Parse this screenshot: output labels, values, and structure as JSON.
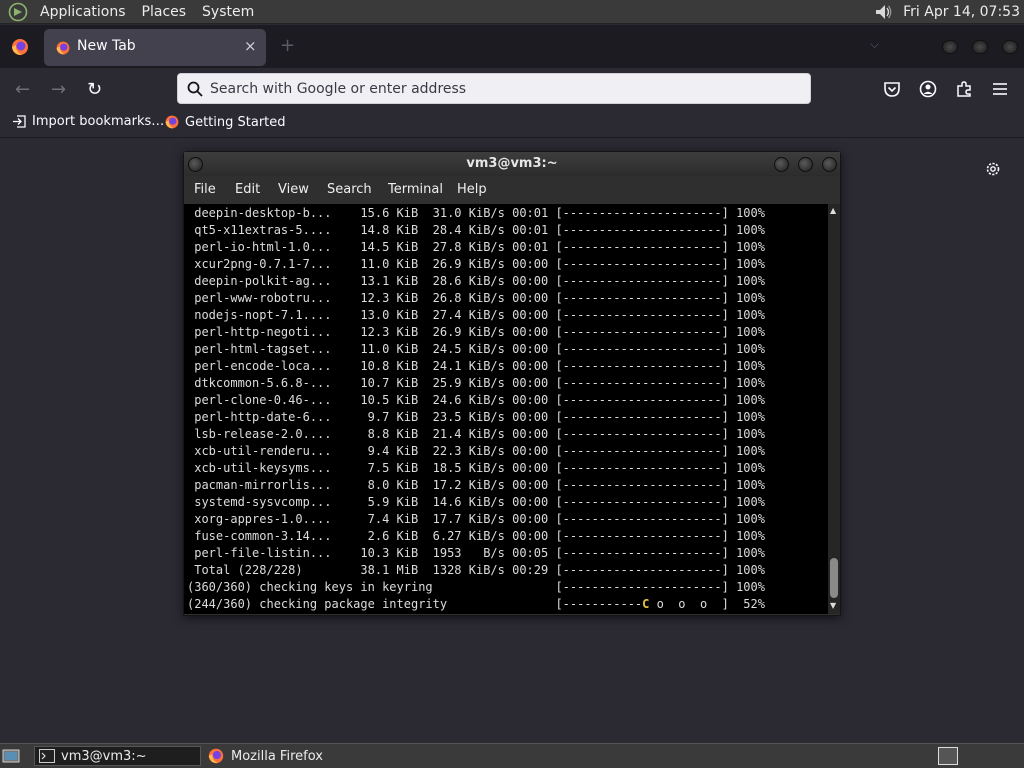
{
  "top_panel": {
    "menus": [
      "Applications",
      "Places",
      "System"
    ],
    "clock": "Fri Apr 14, 07:53",
    "icons": [
      "mate-logo-icon",
      "volume-icon"
    ]
  },
  "browser": {
    "tab": {
      "label": "New Tab",
      "close": "×"
    },
    "new_tab": "+",
    "list_tabs": "⌵",
    "nav": {
      "back": "←",
      "forward": "→",
      "reload": "↻"
    },
    "urlbar": {
      "placeholder": "Search with Google or enter address",
      "value": ""
    },
    "toolbar_icons": [
      "pocket-icon",
      "account-icon",
      "extensions-icon",
      "menu-icon"
    ],
    "bookmarks": [
      {
        "label": "Import bookmarks…",
        "icon": "import-icon"
      },
      {
        "label": "Getting Started",
        "icon": "firefox-icon"
      }
    ],
    "accent": "#1c1b22",
    "content_bg": "#2b2a33"
  },
  "terminal": {
    "title": "vm3@vm3:~",
    "menus": [
      "File",
      "Edit",
      "View",
      "Search",
      "Terminal",
      "Help"
    ],
    "lines": [
      " deepin-desktop-b...    15.6 KiB  31.0 KiB/s 00:01 [----------------------] 100%",
      " qt5-x11extras-5....    14.8 KiB  28.4 KiB/s 00:01 [----------------------] 100%",
      " perl-io-html-1.0...    14.5 KiB  27.8 KiB/s 00:01 [----------------------] 100%",
      " xcur2png-0.7.1-7...    11.0 KiB  26.9 KiB/s 00:00 [----------------------] 100%",
      " deepin-polkit-ag...    13.1 KiB  28.6 KiB/s 00:00 [----------------------] 100%",
      " perl-www-robotru...    12.3 KiB  26.8 KiB/s 00:00 [----------------------] 100%",
      " nodejs-nopt-7.1....    13.0 KiB  27.4 KiB/s 00:00 [----------------------] 100%",
      " perl-http-negoti...    12.3 KiB  26.9 KiB/s 00:00 [----------------------] 100%",
      " perl-html-tagset...    11.0 KiB  24.5 KiB/s 00:00 [----------------------] 100%",
      " perl-encode-loca...    10.8 KiB  24.1 KiB/s 00:00 [----------------------] 100%",
      " dtkcommon-5.6.8-...    10.7 KiB  25.9 KiB/s 00:00 [----------------------] 100%",
      " perl-clone-0.46-...    10.5 KiB  24.6 KiB/s 00:00 [----------------------] 100%",
      " perl-http-date-6...     9.7 KiB  23.5 KiB/s 00:00 [----------------------] 100%",
      " lsb-release-2.0....     8.8 KiB  21.4 KiB/s 00:00 [----------------------] 100%",
      " xcb-util-renderu...     9.4 KiB  22.3 KiB/s 00:00 [----------------------] 100%",
      " xcb-util-keysyms...     7.5 KiB  18.5 KiB/s 00:00 [----------------------] 100%",
      " pacman-mirrorlis...     8.0 KiB  17.2 KiB/s 00:00 [----------------------] 100%",
      " systemd-sysvcomp...     5.9 KiB  14.6 KiB/s 00:00 [----------------------] 100%",
      " xorg-appres-1.0....     7.4 KiB  17.7 KiB/s 00:00 [----------------------] 100%",
      " fuse-common-3.14...     2.6 KiB  6.27 KiB/s 00:00 [----------------------] 100%",
      " perl-file-listin...    10.3 KiB  1953   B/s 00:05 [----------------------] 100%",
      " Total (228/228)        38.1 MiB  1328 KiB/s 00:29 [----------------------] 100%",
      "(360/360) checking keys in keyring                 [----------------------] 100%"
    ],
    "last_line": {
      "prefix": "(244/360) checking package integrity               [-----------",
      "pacman": "C",
      "suffix": " o  o  o  ]  52%"
    },
    "scroll_icons": [
      "scroll-up-icon",
      "scroll-down-icon"
    ]
  },
  "taskbar": {
    "tasks": [
      {
        "label": "vm3@vm3:~",
        "icon": "terminal-icon",
        "active": true
      },
      {
        "label": "Mozilla Firefox",
        "icon": "firefox-icon",
        "active": false
      }
    ],
    "icons": [
      "show-desktop-icon",
      "workspace-switcher-icon"
    ]
  }
}
